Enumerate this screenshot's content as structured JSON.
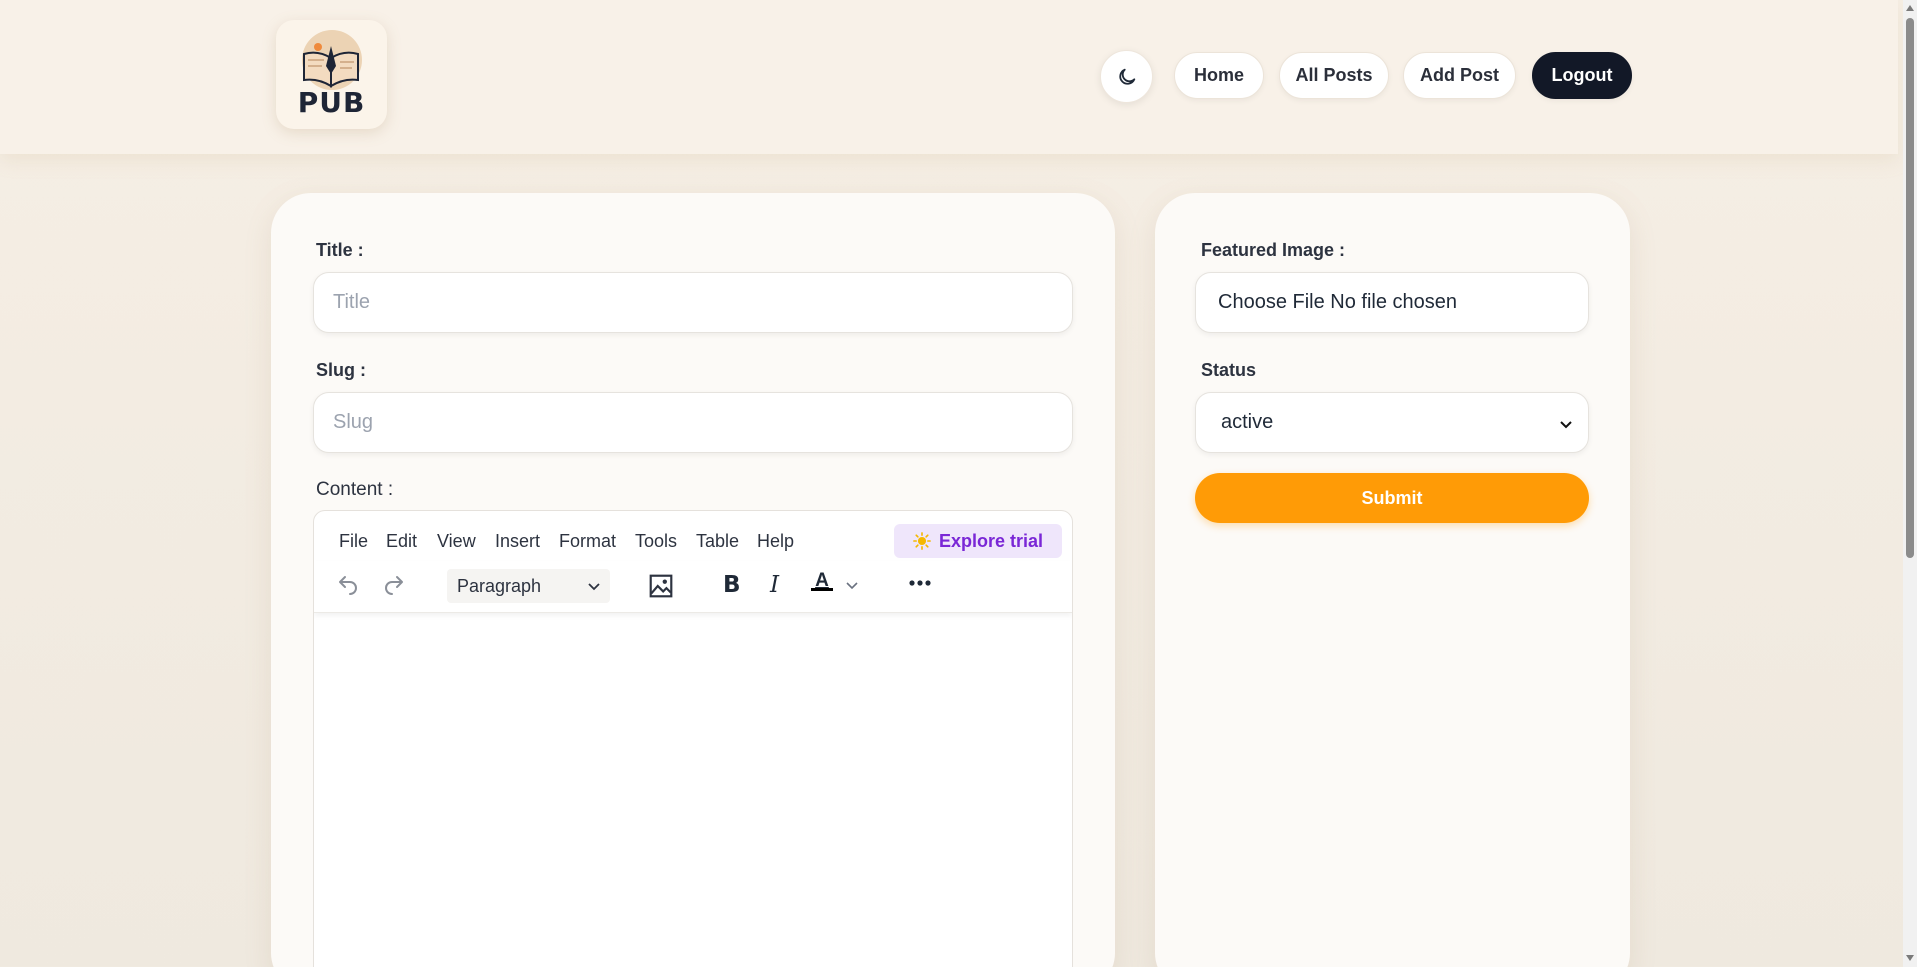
{
  "header": {
    "logo_text": "PUB",
    "nav": {
      "home": "Home",
      "all_posts": "All Posts",
      "add_post": "Add Post",
      "logout": "Logout"
    }
  },
  "form": {
    "title_label": "Title :",
    "title_placeholder": "Title",
    "slug_label": "Slug :",
    "slug_placeholder": "Slug",
    "content_label": "Content :",
    "featured_image_label": "Featured Image :",
    "file_input_text": "Choose File No file chosen",
    "status_label": "Status",
    "status_value": "active",
    "submit_label": "Submit"
  },
  "editor": {
    "menu": [
      "File",
      "Edit",
      "View",
      "Insert",
      "Format",
      "Tools",
      "Table",
      "Help"
    ],
    "trial_label": "Explore trial",
    "block_format": "Paragraph"
  },
  "colors": {
    "accent": "#ff9b06",
    "dark": "#121827",
    "trial": "#7a27d6"
  }
}
